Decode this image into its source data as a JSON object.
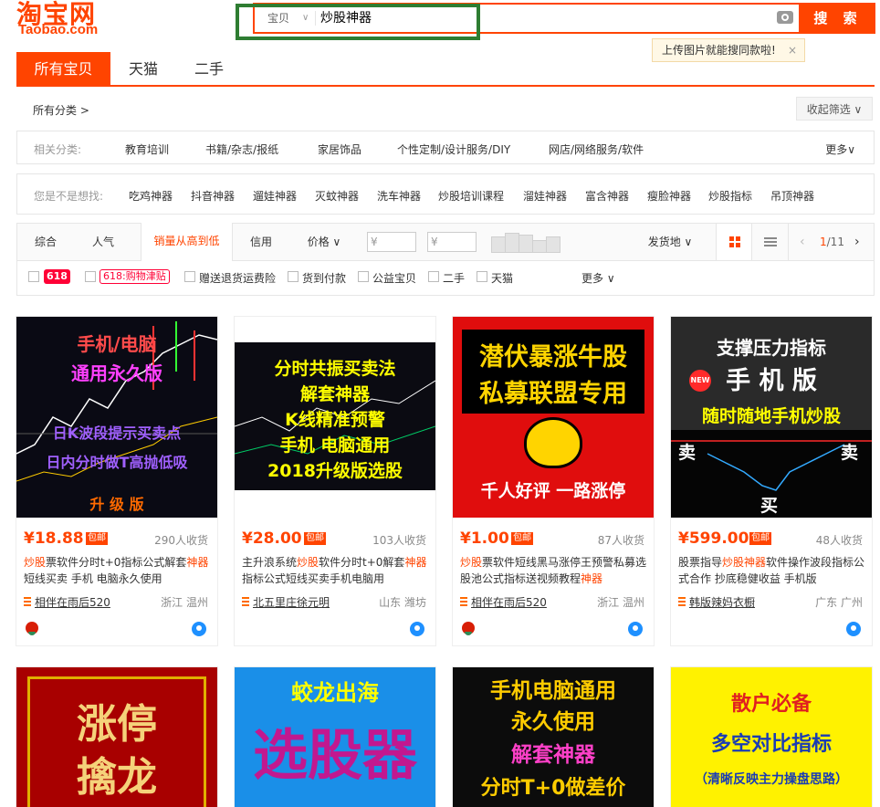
{
  "brand": {
    "logo_cn": "淘宝网",
    "logo_en": "Taobao.com",
    "color": "#ff4400"
  },
  "search": {
    "type": "宝贝",
    "query": "炒股神器",
    "button": "搜 索",
    "tip": "上传图片就能搜同款啦!",
    "tip_close": "×"
  },
  "tabs": [
    "所有宝贝",
    "天猫",
    "二手"
  ],
  "crumb": "所有分类 >",
  "collapse": "收起筛选 ∨",
  "related": {
    "label": "相关分类:",
    "items": [
      "教育培训",
      "书籍/杂志/报纸",
      "家居饰品",
      "个性定制/设计服务/DIY",
      "网店/网络服务/软件"
    ],
    "more": "更多∨"
  },
  "suggest": {
    "label": "您是不是想找:",
    "items": [
      "吃鸡神器",
      "抖音神器",
      "遛娃神器",
      "灭蚊神器",
      "洗车神器",
      "炒股培训课程",
      "溜娃神器",
      "富含神器",
      "瘦脸神器",
      "炒股指标",
      "吊顶神器"
    ]
  },
  "sort": {
    "items": [
      "综合",
      "人气",
      "销量从高到低",
      "信用",
      "价格 ∨"
    ],
    "price_from": "¥",
    "price_to": "¥",
    "ship": "发货地 ∨",
    "page_current": "1",
    "page_total": "/11",
    "prev": "‹",
    "next": "›"
  },
  "filters": {
    "badge1": "618",
    "badge2": "618:购物津贴",
    "items": [
      "赠送退货运费险",
      "货到付款",
      "公益宝贝",
      "二手",
      "天猫"
    ],
    "more": "更多 ∨"
  },
  "products": [
    {
      "price": "¥18.88",
      "baoyou": "包邮",
      "sold": "290人收货",
      "title_pre": "",
      "title_hl1": "炒股",
      "title_mid": "票软件分时t+0指标公式解套",
      "title_hl2": "神器",
      "title_post": "短线买卖 手机 电脑永久使用",
      "shop": "相伴在雨后520",
      "loc": "浙江 温州"
    },
    {
      "price": "¥28.00",
      "baoyou": "包邮",
      "sold": "103人收货",
      "title_pre": "主升浪系统",
      "title_hl1": "炒股",
      "title_mid": "软件分时t+0解套",
      "title_hl2": "神器",
      "title_post": "指标公式短线买卖手机电脑用",
      "shop": "北五里庄徐元明",
      "loc": "山东 潍坊"
    },
    {
      "price": "¥1.00",
      "baoyou": "包邮",
      "sold": "87人收货",
      "title_pre": "",
      "title_hl1": "炒股",
      "title_mid": "票软件短线黑马涨停王预警私募选股池公式指标送视频教程",
      "title_hl2": "神器",
      "title_post": "",
      "shop": "相伴在雨后520",
      "loc": "浙江 温州"
    },
    {
      "price": "¥599.00",
      "baoyou": "包邮",
      "sold": "48人收货",
      "title_pre": "股票指导",
      "title_hl1": "炒股神器",
      "title_mid": "软件操作波段指标公式合作 抄底稳健收益 手机版",
      "title_hl2": "",
      "title_post": "",
      "shop": "韩版辣妈衣橱",
      "loc": "广东 广州"
    }
  ],
  "img_text": {
    "p1": [
      "手机/电脑",
      "通用永久版",
      "日K波段提示买卖点",
      "日内分时做T高抛低吸",
      "升 级 版"
    ],
    "p2": [
      "分时共振买卖法",
      "解套神器",
      "K线精准预警",
      "手机 电脑通用",
      "2018升级版选股"
    ],
    "p3": [
      "潜伏暴涨牛股",
      "私募联盟专用",
      "千人好评 一路涨停"
    ],
    "p4": [
      "支撑压力指标",
      "手 机 版",
      "随时随地手机炒股",
      "卖",
      "卖",
      "买",
      "NEW"
    ],
    "p5": [
      "涨停",
      "擒龙"
    ],
    "p6": [
      "蛟龙出海",
      "选股器"
    ],
    "p7": [
      "手机电脑通用",
      "永久使用",
      "解套神器",
      "分时T+0做差价"
    ],
    "p8": [
      "散户必备",
      "多空对比指标",
      "（清晰反映主力操盘思路）"
    ]
  }
}
